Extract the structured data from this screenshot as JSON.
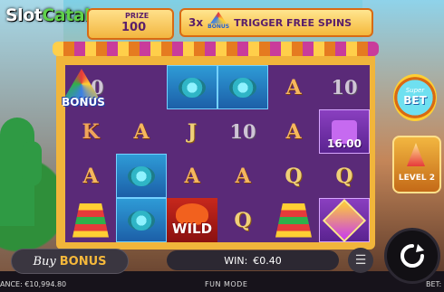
{
  "logo": {
    "part1": "Slot",
    "part2": "Catalog"
  },
  "prize": {
    "label": "PRIZE",
    "value": "100"
  },
  "trigger_banner": {
    "multiplier": "3x",
    "icon_label": "BONUS",
    "text": "TRIGGER FREE SPINS"
  },
  "reels": {
    "rows": [
      [
        "10",
        "BONUS",
        "candy",
        "candy",
        "A",
        "10"
      ],
      [
        "K",
        "A",
        "J",
        "10",
        "A",
        "pinata"
      ],
      [
        "A",
        "candy",
        "A",
        "A",
        "Q",
        "Q"
      ],
      [
        "pyramid",
        "candy",
        "WILD",
        "Q",
        "pyramid",
        "gem"
      ]
    ],
    "bonus_label": "BONUS",
    "wild_label": "WILD",
    "pinata_value": "16.00"
  },
  "side_panel": {
    "super_bet_line1": "Super",
    "super_bet_line2": "BET",
    "level_label": "LEVEL 2"
  },
  "bottom": {
    "buy_bonus_word1": "Buy",
    "buy_bonus_word2": "BONUS",
    "win_label": "WIN:",
    "win_value": "€0.40",
    "balance_text": "ANCE: €10,994.80",
    "fun_mode": "FUN MODE",
    "bet_label": "BET:"
  }
}
